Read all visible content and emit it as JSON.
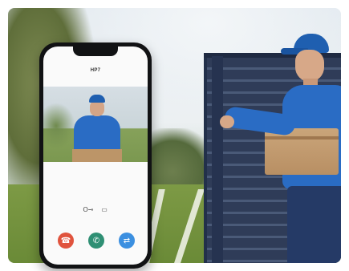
{
  "call_screen": {
    "title": "HP7",
    "controls": {
      "unlock_icon": "key-icon",
      "unlock_glyph": "O⊸",
      "record_icon": "camera-icon",
      "record_glyph": "▭"
    },
    "buttons": {
      "decline": {
        "icon": "hang-up-icon",
        "glyph": "☎",
        "color": "#e0533d"
      },
      "answer": {
        "icon": "phone-icon",
        "glyph": "✆",
        "color": "#2f8f74"
      },
      "other": {
        "icon": "swap-icon",
        "glyph": "⇄",
        "color": "#3b8fe0"
      }
    }
  },
  "scene": {
    "accent_colors": {
      "uniform": "#2a6cc4",
      "fence": "#2f3c58",
      "lawn": "#6a8a37"
    }
  }
}
